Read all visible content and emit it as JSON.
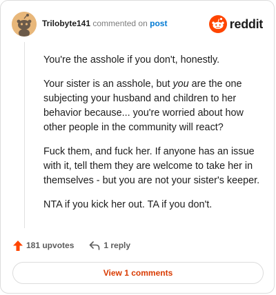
{
  "header": {
    "username": "Trilobyte141",
    "action_text": "commented on",
    "post_link": "post",
    "brand": "reddit"
  },
  "comment": {
    "paragraphs": [
      {
        "text": "You're the asshole if you don't, honestly."
      },
      {
        "before": "Your sister is an asshole, but ",
        "em": "you",
        "after": " are the one subjecting your husband and children to her behavior because... you're worried about how other people in the community will react?"
      },
      {
        "text": "Fuck them, and fuck her. If anyone has an issue with it, tell them they are welcome to take her in themselves - but you are not your sister's keeper."
      },
      {
        "text": "NTA if you kick her out. TA if you don't."
      }
    ]
  },
  "actions": {
    "upvotes_label": "181 upvotes",
    "reply_label": "1 reply"
  },
  "footer": {
    "view_comments_label": "View 1 comments"
  },
  "colors": {
    "brand_orange": "#ff4500",
    "link_blue": "#0079d3",
    "button_text": "#d93a00"
  },
  "icons": [
    "snoo-avatar-icon",
    "reddit-logo-icon",
    "upvote-arrow-icon",
    "reply-arrow-icon"
  ]
}
